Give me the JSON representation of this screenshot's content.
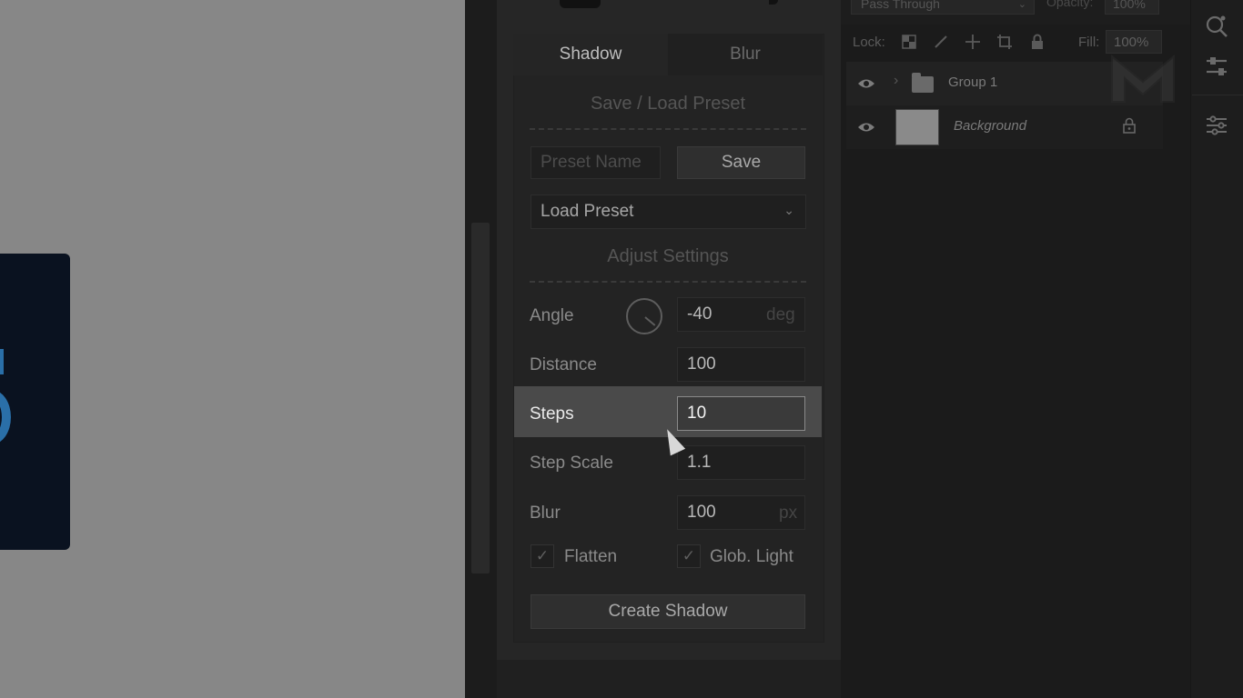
{
  "plugin": {
    "tabs": [
      {
        "label": "Shadow",
        "active": true
      },
      {
        "label": "Blur",
        "active": false
      }
    ],
    "preset_section_title": "Save / Load Preset",
    "preset_name_placeholder": "Preset Name",
    "save_label": "Save",
    "load_preset_label": "Load Preset",
    "adjust_section_title": "Adjust Settings",
    "angle": {
      "label": "Angle",
      "value": "-40",
      "unit": "deg"
    },
    "distance": {
      "label": "Distance",
      "value": "100"
    },
    "steps": {
      "label": "Steps",
      "value": "10"
    },
    "step_scale": {
      "label": "Step Scale",
      "value": "1.1"
    },
    "blur": {
      "label": "Blur",
      "value": "100",
      "unit": "px"
    },
    "flatten": {
      "label": "Flatten",
      "checked": true
    },
    "global_light": {
      "label": "Glob. Light",
      "checked": true
    },
    "create_label": "Create Shadow",
    "check_glyph": "✓"
  },
  "layers_panel": {
    "blend_mode": "Pass Through",
    "opacity_label": "Opacity:",
    "opacity_value": "100%",
    "lock_label": "Lock:",
    "fill_label": "Fill:",
    "fill_value": "100%",
    "layers": [
      {
        "name": "Group 1",
        "type": "group",
        "visible": true
      },
      {
        "name": "Background",
        "type": "background",
        "visible": true,
        "locked": true
      }
    ]
  },
  "icons": {
    "eye": "◉",
    "chevron_down": "⌄",
    "chevron_right": "›",
    "lock": "🔒"
  },
  "colors": {
    "canvas": "#878787",
    "panel": "#262626",
    "highlight": "#4a4a4a",
    "artwork_accent": "#2a6fa8"
  }
}
